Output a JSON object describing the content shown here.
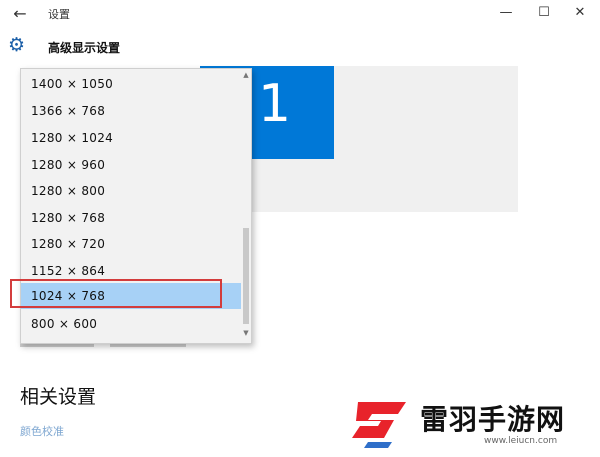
{
  "window": {
    "title": "设置",
    "back_glyph": "←",
    "minimize_glyph": "—",
    "maximize_glyph": "☐",
    "close_glyph": "✕"
  },
  "header": {
    "icon": "gear-icon",
    "title": "高级显示设置"
  },
  "display": {
    "monitor_number": "1",
    "accent_color": "#0078d7"
  },
  "resolution_dropdown": {
    "options": [
      "1400 × 1050",
      "1366 × 768",
      "1280 × 1024",
      "1280 × 960",
      "1280 × 800",
      "1280 × 768",
      "1280 × 720",
      "1152 × 864",
      "1024 × 768",
      "800 × 600"
    ],
    "selected": "1024 × 768",
    "selected_color": "#a7d1f6",
    "highlight_color": "#d33c3c",
    "scroll_up_glyph": "▲",
    "scroll_down_glyph": "▼"
  },
  "related": {
    "title": "相关设置",
    "links": [
      "颜色校准"
    ]
  },
  "watermark": {
    "name": "雷羽手游网",
    "url": "www.leiucn.com",
    "brand_color": "#e8232b"
  }
}
